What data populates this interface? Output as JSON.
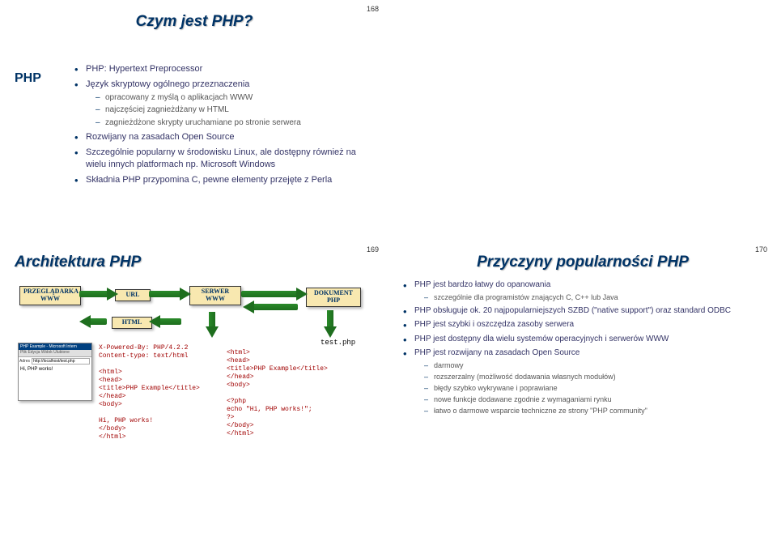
{
  "slides": {
    "s168": {
      "number": "168",
      "title": "Czym jest PHP?",
      "label": "PHP",
      "bullets": [
        {
          "text": "PHP: Hypertext Preprocessor"
        },
        {
          "text": "Język skryptowy ogólnego przeznaczenia",
          "sub": [
            "opracowany z myślą o aplikacjach WWW",
            "najczęściej zagnieżdżany w HTML",
            "zagnieżdżone skrypty uruchamiane po stronie serwera"
          ]
        },
        {
          "text": "Rozwijany na zasadach Open Source"
        },
        {
          "text": "Szczególnie popularny w środowisku Linux, ale dostępny również na wielu innych platformach np. Microsoft Windows"
        },
        {
          "text": "Składnia PHP przypomina C, pewne elementy przejęte z Perla"
        }
      ]
    },
    "s169": {
      "number": "169",
      "title": "Architektura PHP",
      "tags": {
        "browser": "PRZEGLĄDARKA\nWWW",
        "url": "URL",
        "server": "SERWER\nWWW",
        "html": "HTML",
        "doc": "DOKUMENT\nPHP"
      },
      "browser": {
        "title": "PHP Example - Microsoft Intern",
        "toolbar": "Plik Edycja Widok Ulubione",
        "addr_label": "Adres",
        "addr": "http://localhost/test.php",
        "body": "Hi, PHP works!"
      },
      "filelabel": "test.php",
      "code_left": "X-Powered-By: PHP/4.2.2\nContent-type: text/html\n\n<html>\n<head>\n<title>PHP Example</title>\n</head>\n<body>\n\nHi, PHP works!\n</body>\n</html>",
      "code_right": "<html>\n<head>\n<title>PHP Example</title>\n</head>\n<body>\n\n<?php\necho \"Hi, PHP works!\";\n?>\n</body>\n</html>"
    },
    "s170": {
      "number": "170",
      "title": "Przyczyny popularności PHP",
      "bullets": [
        {
          "text": "PHP jest bardzo łatwy do opanowania",
          "sub": [
            "szczególnie dla programistów znających C, C++ lub Java"
          ]
        },
        {
          "text": "PHP obsługuje ok. 20 najpopularniejszych SZBD (\"native support\") oraz standard ODBC"
        },
        {
          "text": "PHP jest szybki i oszczędza zasoby serwera"
        },
        {
          "text": "PHP jest dostępny dla wielu systemów operacyjnych i serwerów WWW"
        },
        {
          "text": "PHP jest rozwijany na zasadach Open Source",
          "sub": [
            "darmowy",
            "rozszerzalny (możliwość dodawania własnych modułów)",
            "błędy szybko wykrywane i poprawiane",
            "nowe funkcje dodawane zgodnie z wymaganiami rynku",
            "łatwo o darmowe wsparcie techniczne ze strony \"PHP community\""
          ]
        }
      ]
    }
  }
}
